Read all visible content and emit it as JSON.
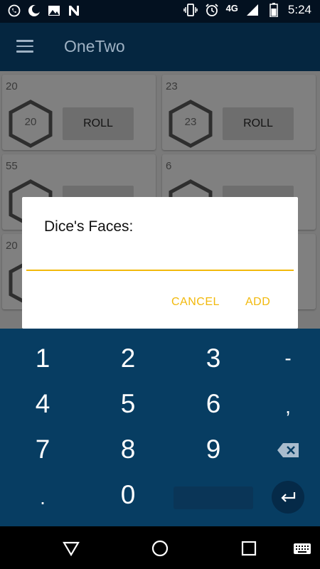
{
  "status_bar": {
    "time": "5:24",
    "network": "4G",
    "left_icons": [
      "whatsapp-icon",
      "moon-icon",
      "image-icon",
      "n-app-icon"
    ],
    "right_icons": [
      "vibrate-icon",
      "alarm-icon",
      "signal-icon",
      "battery-icon"
    ]
  },
  "app_bar": {
    "title": "OneTwo",
    "menu_icon": "hamburger-menu-icon"
  },
  "dice_cards": [
    {
      "number": "20",
      "hex_value": "20",
      "roll_label": "ROLL"
    },
    {
      "number": "23",
      "hex_value": "23",
      "roll_label": "ROLL"
    },
    {
      "number": "55",
      "hex_value": "",
      "roll_label": ""
    },
    {
      "number": "6",
      "hex_value": "",
      "roll_label": ""
    },
    {
      "number": "20",
      "hex_value": "",
      "roll_label": ""
    }
  ],
  "dialog": {
    "title": "Dice's Faces:",
    "input_value": "",
    "cancel_label": "CANCEL",
    "add_label": "ADD"
  },
  "keyboard": {
    "row1": [
      "1",
      "2",
      "3",
      "-"
    ],
    "row2": [
      "4",
      "5",
      "6",
      ","
    ],
    "row3": [
      "7",
      "8",
      "9"
    ],
    "row4": [
      ".",
      "0"
    ],
    "backspace_icon": "backspace-icon",
    "enter_icon": "enter-icon"
  },
  "nav_bar": {
    "icons": [
      "back-icon",
      "home-icon",
      "recents-icon",
      "keyboard-icon"
    ]
  },
  "colors": {
    "accent": "#f2b90c",
    "app_bar": "#052640",
    "keyboard": "#073d62"
  }
}
